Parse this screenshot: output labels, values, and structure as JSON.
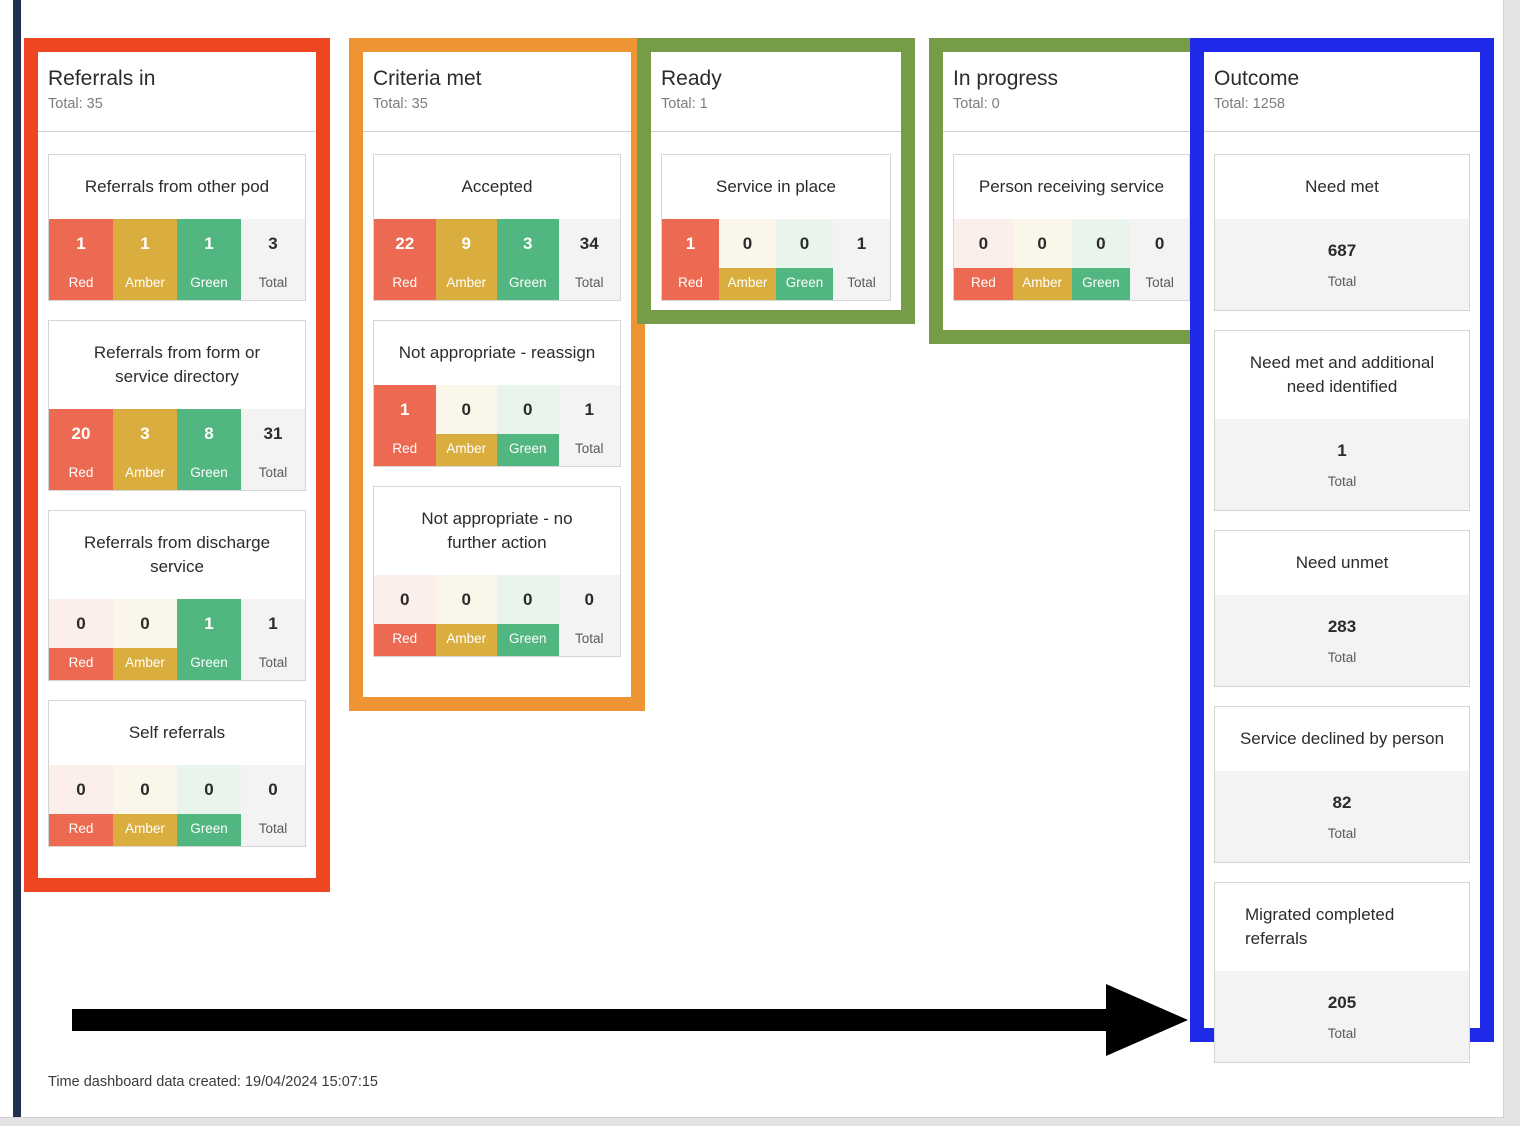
{
  "colors": {
    "referrals_frame": "#ee4623",
    "criteria_frame": "#ef9432",
    "ready_frame": "#779c47",
    "inprogress_frame": "#779c47",
    "outcome_frame": "#1f2ae8",
    "red": "#ec6a51",
    "amber": "#d9ae3f",
    "green": "#51b67f",
    "total_grey": "#f3f3f3",
    "left_rail": "#1f3050",
    "arrow": "#000000"
  },
  "rag_labels": {
    "red": "Red",
    "amber": "Amber",
    "green": "Green",
    "total": "Total"
  },
  "columns": [
    {
      "key": "referrals_in",
      "title": "Referrals in",
      "total_label": "Total: 35",
      "cards": [
        {
          "title": "Referrals from other pod",
          "red": "1",
          "amber": "1",
          "green": "1",
          "total": "3"
        },
        {
          "title": "Referrals from form or service directory",
          "red": "20",
          "amber": "3",
          "green": "8",
          "total": "31"
        },
        {
          "title": "Referrals from discharge service",
          "red": "0",
          "amber": "0",
          "green": "1",
          "total": "1"
        },
        {
          "title": "Self referrals",
          "red": "0",
          "amber": "0",
          "green": "0",
          "total": "0"
        }
      ]
    },
    {
      "key": "criteria_met",
      "title": "Criteria met",
      "total_label": "Total: 35",
      "cards": [
        {
          "title": "Accepted",
          "red": "22",
          "amber": "9",
          "green": "3",
          "total": "34"
        },
        {
          "title": "Not appropriate - reassign",
          "red": "1",
          "amber": "0",
          "green": "0",
          "total": "1"
        },
        {
          "title": "Not appropriate - no further action",
          "red": "0",
          "amber": "0",
          "green": "0",
          "total": "0"
        }
      ]
    },
    {
      "key": "ready",
      "title": "Ready",
      "total_label": "Total: 1",
      "cards": [
        {
          "title": "Service in place",
          "red": "1",
          "amber": "0",
          "green": "0",
          "total": "1"
        }
      ]
    },
    {
      "key": "in_progress",
      "title": "In progress",
      "total_label": "Total: 0",
      "cards": [
        {
          "title": "Person receiving service",
          "red": "0",
          "amber": "0",
          "green": "0",
          "total": "0"
        }
      ]
    },
    {
      "key": "outcome",
      "title": "Outcome",
      "total_label": "Total: 1258",
      "total_only": true,
      "cards": [
        {
          "title": "Need met",
          "total": "687"
        },
        {
          "title": "Need met and additional need identified",
          "total": "1"
        },
        {
          "title": "Need unmet",
          "total": "283"
        },
        {
          "title": "Service declined by person",
          "total": "82"
        },
        {
          "title": "Migrated completed referrals",
          "total": "205",
          "align": "left"
        }
      ]
    }
  ],
  "footer": {
    "text": "Time dashboard data created: 19/04/2024 15:07:15"
  }
}
